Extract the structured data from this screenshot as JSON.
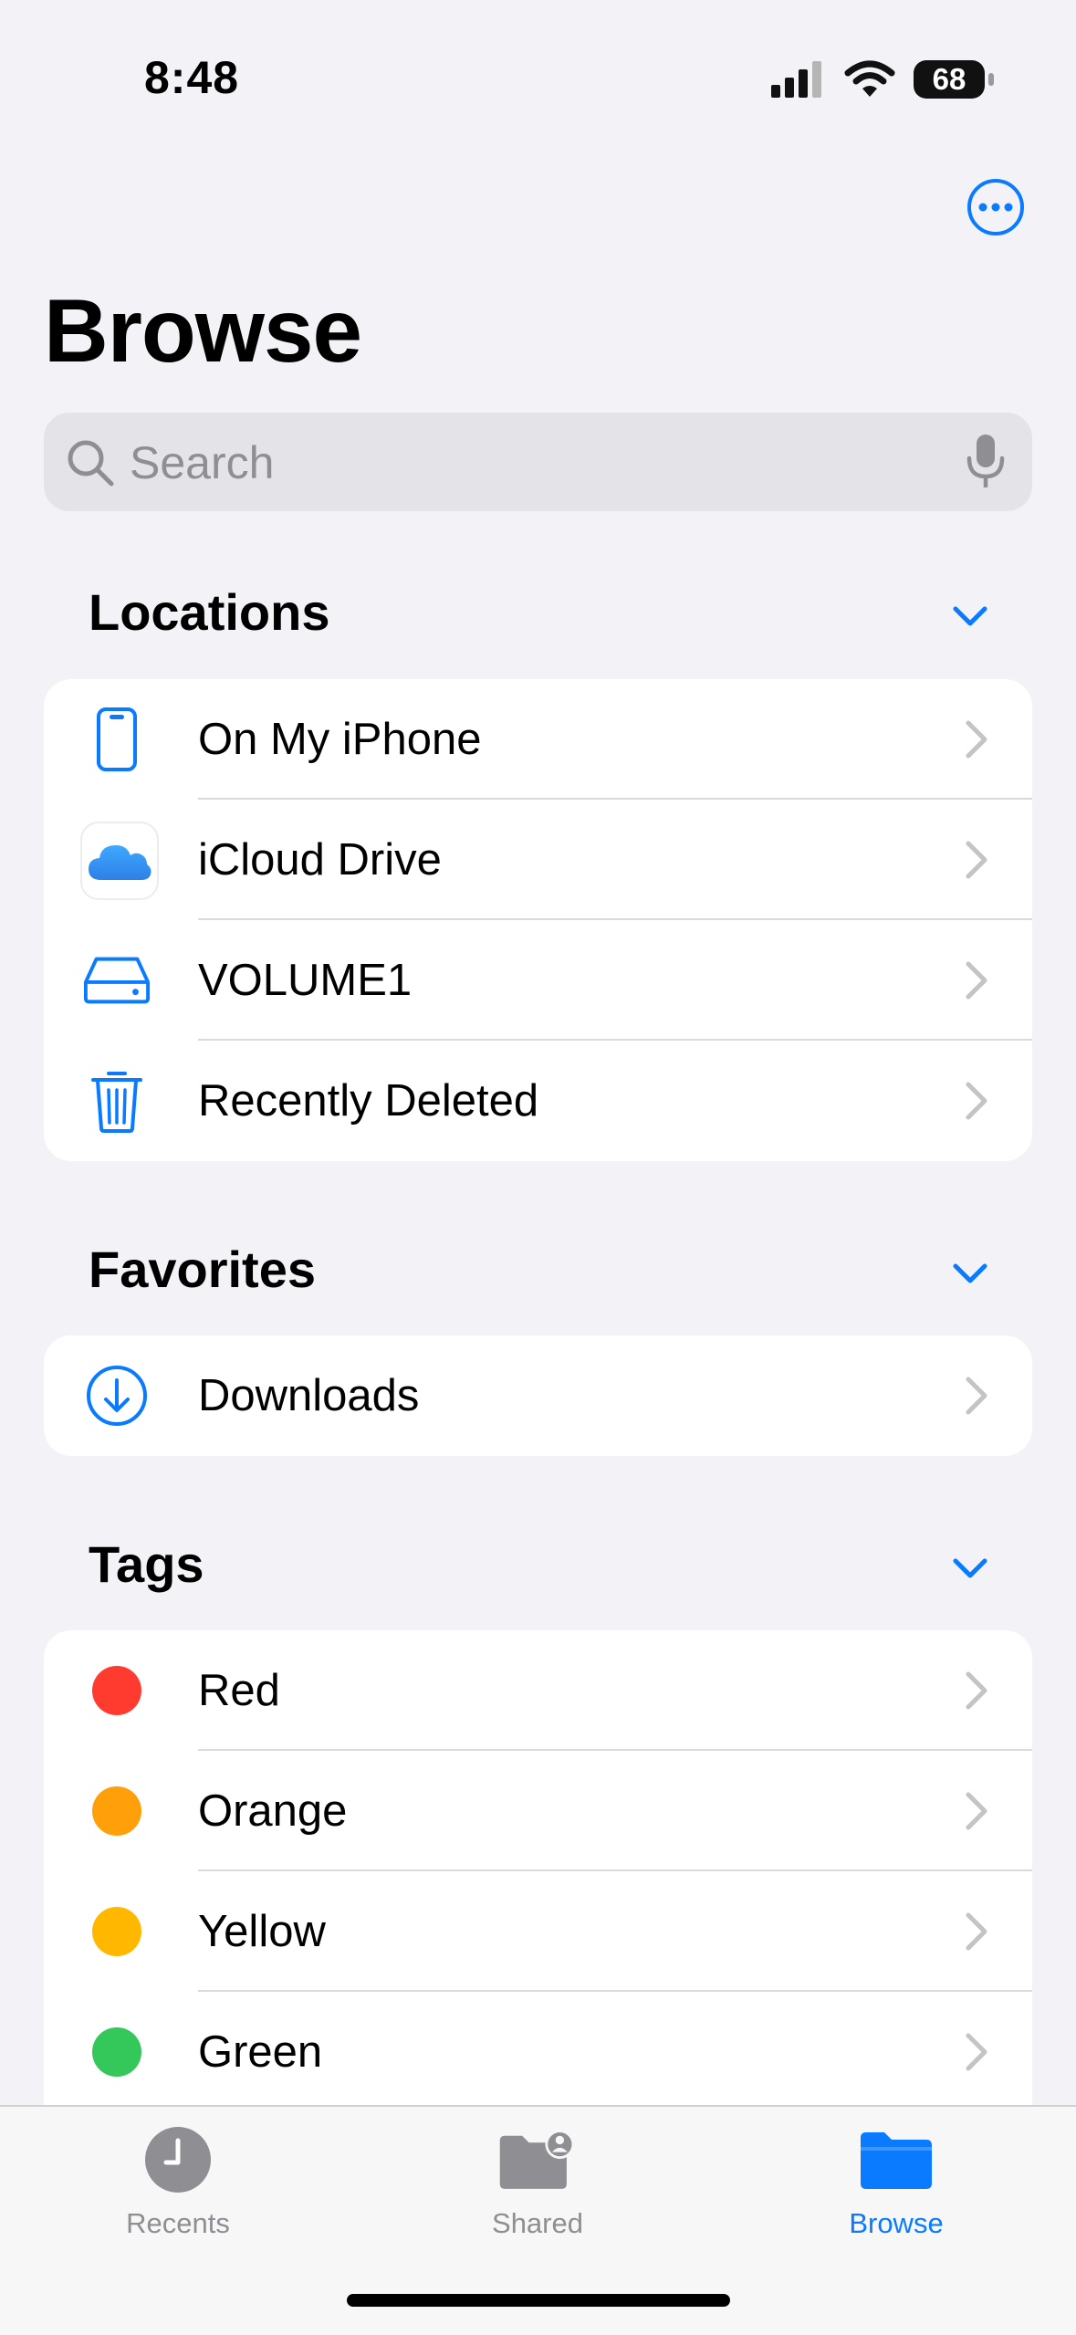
{
  "status_bar": {
    "time": "8:48",
    "battery": "68"
  },
  "header": {
    "title": "Browse",
    "more_icon": "ellipsis-circle-icon"
  },
  "search": {
    "placeholder": "Search",
    "value": ""
  },
  "sections": {
    "locations": {
      "title": "Locations",
      "items": [
        {
          "label": "On My iPhone",
          "icon": "iphone-icon"
        },
        {
          "label": "iCloud Drive",
          "icon": "icloud-icon"
        },
        {
          "label": "VOLUME1",
          "icon": "drive-icon"
        },
        {
          "label": "Recently Deleted",
          "icon": "trash-icon"
        }
      ]
    },
    "favorites": {
      "title": "Favorites",
      "items": [
        {
          "label": "Downloads",
          "icon": "download-circle-icon"
        }
      ]
    },
    "tags": {
      "title": "Tags",
      "items": [
        {
          "label": "Red",
          "color": "#ff3b30"
        },
        {
          "label": "Orange",
          "color": "#ff9f0a"
        },
        {
          "label": "Yellow",
          "color": "#ffb700"
        },
        {
          "label": "Green",
          "color": "#34c759"
        }
      ]
    }
  },
  "tabbar": {
    "tabs": [
      {
        "label": "Recents",
        "icon": "clock-icon",
        "active": false
      },
      {
        "label": "Shared",
        "icon": "shared-folder-icon",
        "active": false
      },
      {
        "label": "Browse",
        "icon": "folder-icon",
        "active": true
      }
    ]
  },
  "colors": {
    "accent": "#0a7aff",
    "background": "#f2f2f7",
    "inactive": "#8e8e93"
  }
}
